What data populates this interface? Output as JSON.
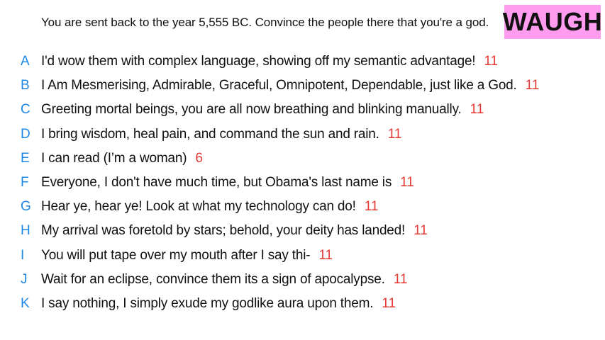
{
  "prompt": "You are sent back to the year 5,555 BC. Convince the people there that you're a god.",
  "name_badge": "WAUGH",
  "colors": {
    "badge_bg": "#ff9cf0",
    "letter": "#1e88e5",
    "score": "#e53935"
  },
  "answers": [
    {
      "letter": "A",
      "text": "I'd wow them with complex language, showing off my semantic advantage!",
      "score": "11"
    },
    {
      "letter": "B",
      "text": "I Am Mesmerising, Admirable, Graceful, Omnipotent, Dependable, just like a God.",
      "score": "11"
    },
    {
      "letter": "C",
      "text": "Greeting mortal beings, you are all now breathing and blinking manually.",
      "score": "11"
    },
    {
      "letter": "D",
      "text": "I bring wisdom, heal pain, and command the sun and rain.",
      "score": "11"
    },
    {
      "letter": "E",
      "text": "I can read (I’m a woman)",
      "score": "6"
    },
    {
      "letter": "F",
      "text": "Everyone, I don't have much time, but Obama's last name is",
      "score": "11"
    },
    {
      "letter": "G",
      "text": "Hear ye, hear ye! Look at what my technology can do!",
      "score": "11"
    },
    {
      "letter": "H",
      "text": "My arrival was foretold by stars; behold, your deity has landed!",
      "score": "11"
    },
    {
      "letter": "I",
      "text": "You will put tape over my mouth after I say thi-",
      "score": "11"
    },
    {
      "letter": "J",
      "text": "Wait for an eclipse, convince them its a sign of apocalypse.",
      "score": "11"
    },
    {
      "letter": "K",
      "text": "I say nothing, I simply exude my godlike aura upon them.",
      "score": "11"
    }
  ]
}
